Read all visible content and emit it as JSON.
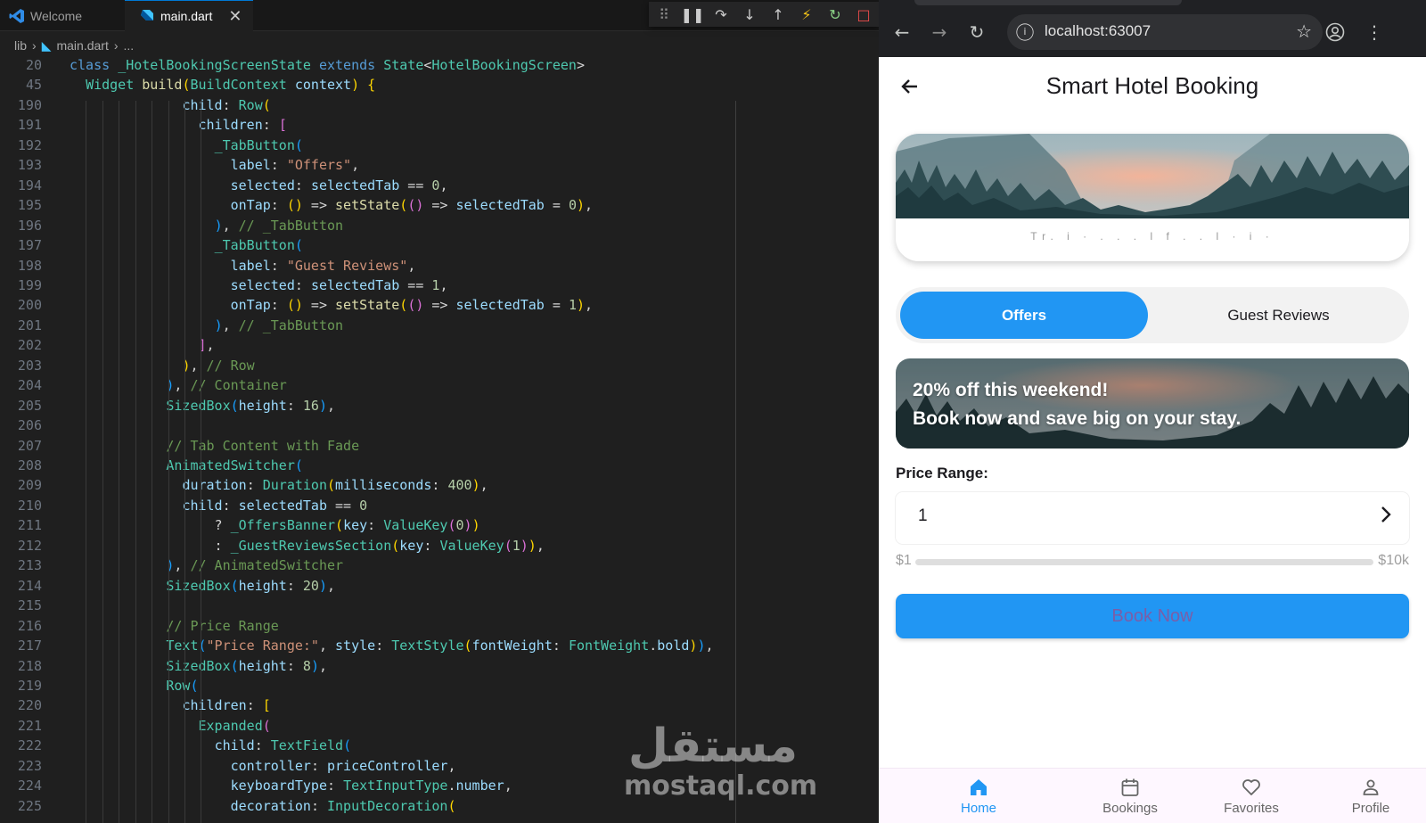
{
  "editor": {
    "tabs": [
      {
        "label": "Welcome",
        "icon": "vscode-icon"
      },
      {
        "label": "main.dart",
        "icon": "dart-icon"
      }
    ],
    "breadcrumb": [
      "lib",
      "main.dart",
      "..."
    ],
    "lines": [
      {
        "n": "20",
        "html": "<span class='k'>class</span> <span class='t'>_HotelBookingScreenState</span> <span class='k'>extends</span> <span class='t'>State</span>&lt;<span class='t'>HotelBookingScreen</span>&gt;"
      },
      {
        "n": "45",
        "html": "  <span class='t'>Widget</span> <span class='f'>build</span><span class='p1'>(</span><span class='t'>BuildContext</span> <span class='v'>context</span><span class='p1'>)</span> <span class='p1'>{</span>"
      },
      {
        "n": "190",
        "html": "              <span class='v'>child</span>: <span class='t'>Row</span><span class='p1'>(</span>"
      },
      {
        "n": "191",
        "html": "                <span class='v'>children</span>: <span class='p2'>[</span>"
      },
      {
        "n": "192",
        "html": "                  <span class='t'>_TabButton</span><span class='p3'>(</span>"
      },
      {
        "n": "193",
        "html": "                    <span class='v'>label</span>: <span class='s'>\"Offers\"</span>,"
      },
      {
        "n": "194",
        "html": "                    <span class='v'>selected</span>: <span class='v'>selectedTab</span> == <span class='n'>0</span>,"
      },
      {
        "n": "195",
        "html": "                    <span class='v'>onTap</span>: <span class='p1'>()</span> =&gt; <span class='f'>setState</span><span class='p1'>(</span><span class='p2'>()</span> =&gt; <span class='v'>selectedTab</span> = <span class='n'>0</span><span class='p1'>)</span>,"
      },
      {
        "n": "196",
        "html": "                  <span class='p3'>)</span>, <span class='c'>// _TabButton</span>"
      },
      {
        "n": "197",
        "html": "                  <span class='t'>_TabButton</span><span class='p3'>(</span>"
      },
      {
        "n": "198",
        "html": "                    <span class='v'>label</span>: <span class='s'>\"Guest Reviews\"</span>,"
      },
      {
        "n": "199",
        "html": "                    <span class='v'>selected</span>: <span class='v'>selectedTab</span> == <span class='n'>1</span>,"
      },
      {
        "n": "200",
        "html": "                    <span class='v'>onTap</span>: <span class='p1'>()</span> =&gt; <span class='f'>setState</span><span class='p1'>(</span><span class='p2'>()</span> =&gt; <span class='v'>selectedTab</span> = <span class='n'>1</span><span class='p1'>)</span>,"
      },
      {
        "n": "201",
        "html": "                  <span class='p3'>)</span>, <span class='c'>// _TabButton</span>"
      },
      {
        "n": "202",
        "html": "                <span class='p2'>]</span>,"
      },
      {
        "n": "203",
        "html": "              <span class='p1'>)</span>, <span class='c'>// Row</span>"
      },
      {
        "n": "204",
        "html": "            <span class='p3'>)</span>, <span class='c'>// Container</span>"
      },
      {
        "n": "205",
        "html": "            <span class='t'>SizedBox</span><span class='p3'>(</span><span class='v'>height</span>: <span class='n'>16</span><span class='p3'>)</span>,"
      },
      {
        "n": "206",
        "html": ""
      },
      {
        "n": "207",
        "html": "            <span class='c'>// Tab Content with Fade</span>"
      },
      {
        "n": "208",
        "html": "            <span class='t'>AnimatedSwitcher</span><span class='p3'>(</span>"
      },
      {
        "n": "209",
        "html": "              <span class='v'>duration</span>: <span class='t'>Duration</span><span class='p1'>(</span><span class='v'>milliseconds</span>: <span class='n'>400</span><span class='p1'>)</span>,"
      },
      {
        "n": "210",
        "html": "              <span class='v'>child</span>: <span class='v'>selectedTab</span> == <span class='n'>0</span>"
      },
      {
        "n": "211",
        "html": "                  ? <span class='t'>_OffersBanner</span><span class='p1'>(</span><span class='v'>key</span>: <span class='t'>ValueKey</span><span class='p2'>(</span><span class='n'>0</span><span class='p2'>)</span><span class='p1'>)</span>"
      },
      {
        "n": "212",
        "html": "                  : <span class='t'>_GuestReviewsSection</span><span class='p1'>(</span><span class='v'>key</span>: <span class='t'>ValueKey</span><span class='p2'>(</span><span class='n'>1</span><span class='p2'>)</span><span class='p1'>)</span>,"
      },
      {
        "n": "213",
        "html": "            <span class='p3'>)</span>, <span class='c'>// AnimatedSwitcher</span>"
      },
      {
        "n": "214",
        "html": "            <span class='t'>SizedBox</span><span class='p3'>(</span><span class='v'>height</span>: <span class='n'>20</span><span class='p3'>)</span>,"
      },
      {
        "n": "215",
        "html": ""
      },
      {
        "n": "216",
        "html": "            <span class='c'>// Price Range</span>"
      },
      {
        "n": "217",
        "html": "            <span class='t'>Text</span><span class='p3'>(</span><span class='s'>\"Price Range:\"</span>, <span class='v'>style</span>: <span class='t'>TextStyle</span><span class='p1'>(</span><span class='v'>fontWeight</span>: <span class='t'>FontWeight</span>.<span class='v'>bold</span><span class='p1'>)</span><span class='p3'>)</span>,"
      },
      {
        "n": "218",
        "html": "            <span class='t'>SizedBox</span><span class='p3'>(</span><span class='v'>height</span>: <span class='n'>8</span><span class='p3'>)</span>,"
      },
      {
        "n": "219",
        "html": "            <span class='t'>Row</span><span class='p3'>(</span>"
      },
      {
        "n": "220",
        "html": "              <span class='v'>children</span>: <span class='p1'>[</span>"
      },
      {
        "n": "221",
        "html": "                <span class='t'>Expanded</span><span class='p2'>(</span>"
      },
      {
        "n": "222",
        "html": "                  <span class='v'>child</span>: <span class='t'>TextField</span><span class='p3'>(</span>"
      },
      {
        "n": "223",
        "html": "                    <span class='v'>controller</span>: <span class='v'>priceController</span>,"
      },
      {
        "n": "224",
        "html": "                    <span class='v'>keyboardType</span>: <span class='t'>TextInputType</span>.<span class='v'>number</span>,"
      },
      {
        "n": "225",
        "html": "                    <span class='v'>decoration</span>: <span class='t'>InputDecoration</span><span class='p1'>(</span>"
      }
    ],
    "watermark_arabic": "مستقل",
    "watermark_latin": "mostaql.com"
  },
  "browser": {
    "url": "localhost:63007",
    "app": {
      "title": "Smart Hotel Booking",
      "tabs": {
        "offers": "Offers",
        "reviews": "Guest Reviews",
        "selected": "offers"
      },
      "offer_line1": "20% off this weekend!",
      "offer_line2": "Book now and save big on your stay.",
      "price_label": "Price Range:",
      "price_value": "1",
      "slider_min_label": "$1",
      "slider_max_label": "$10k",
      "slider_fraction": 0.0,
      "book_button": "Book Now",
      "nav": [
        {
          "label": "Home",
          "icon": "home-icon",
          "active": true
        },
        {
          "label": "Bookings",
          "icon": "calendar-icon",
          "active": false
        },
        {
          "label": "Favorites",
          "icon": "heart-icon",
          "active": false
        },
        {
          "label": "Profile",
          "icon": "person-icon",
          "active": false
        }
      ],
      "accent_color": "#2196f3"
    }
  }
}
